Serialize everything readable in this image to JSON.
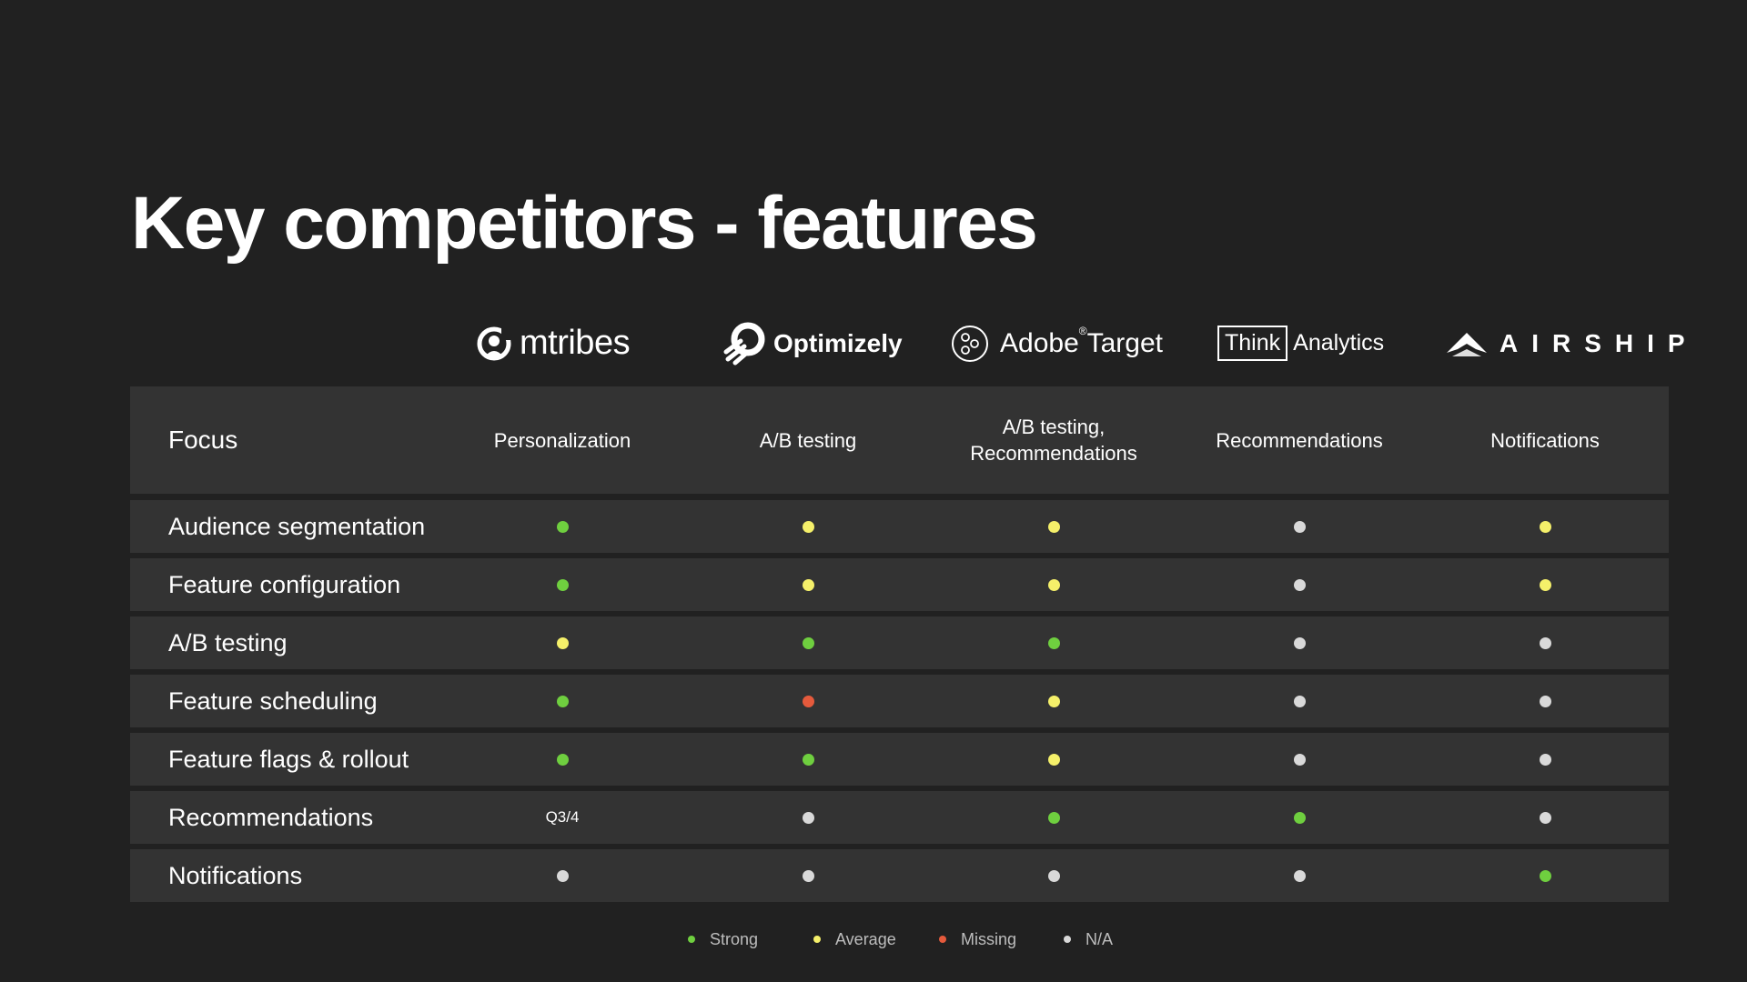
{
  "title": "Key competitors - features",
  "competitors": [
    {
      "name": "mtribes",
      "icon": "mtribes-logo-icon"
    },
    {
      "name": "Optimizely",
      "icon": "optimizely-logo-icon"
    },
    {
      "name": "Adobe",
      "name_suffix": "Target",
      "registered": "®",
      "icon": "adobe-target-logo-icon"
    },
    {
      "name": "Think",
      "name_suffix": "Analytics",
      "icon": "think-analytics-logo"
    },
    {
      "name": "AIRSHIP",
      "icon": "airship-logo-icon"
    }
  ],
  "header": {
    "label": "Focus",
    "values": [
      "Personalization",
      "A/B testing",
      "A/B testing,\nRecommendations",
      "Recommendations",
      "Notifications"
    ]
  },
  "rows": [
    {
      "label": "Audience segmentation",
      "cells": [
        "strong",
        "average",
        "average",
        "na",
        "average"
      ]
    },
    {
      "label": "Feature configuration",
      "cells": [
        "strong",
        "average",
        "average",
        "na",
        "average"
      ]
    },
    {
      "label": "A/B testing",
      "cells": [
        "average",
        "strong",
        "strong",
        "na",
        "na"
      ]
    },
    {
      "label": "Feature scheduling",
      "cells": [
        "strong",
        "missing",
        "average",
        "na",
        "na"
      ]
    },
    {
      "label": "Feature flags & rollout",
      "cells": [
        "strong",
        "strong",
        "average",
        "na",
        "na"
      ]
    },
    {
      "label": "Recommendations",
      "cells": [
        "text:Q3/4",
        "na",
        "strong",
        "strong",
        "na"
      ]
    },
    {
      "label": "Notifications",
      "cells": [
        "na",
        "na",
        "na",
        "na",
        "strong"
      ]
    }
  ],
  "legend": [
    {
      "key": "strong",
      "label": "Strong"
    },
    {
      "key": "average",
      "label": "Average"
    },
    {
      "key": "missing",
      "label": "Missing"
    },
    {
      "key": "na",
      "label": "N/A"
    }
  ],
  "colors": {
    "background": "#212121",
    "row": "#333333",
    "strong": "#6fcf3f",
    "average": "#f5f06a",
    "missing": "#e55a3c",
    "na": "#d9d9d9"
  }
}
